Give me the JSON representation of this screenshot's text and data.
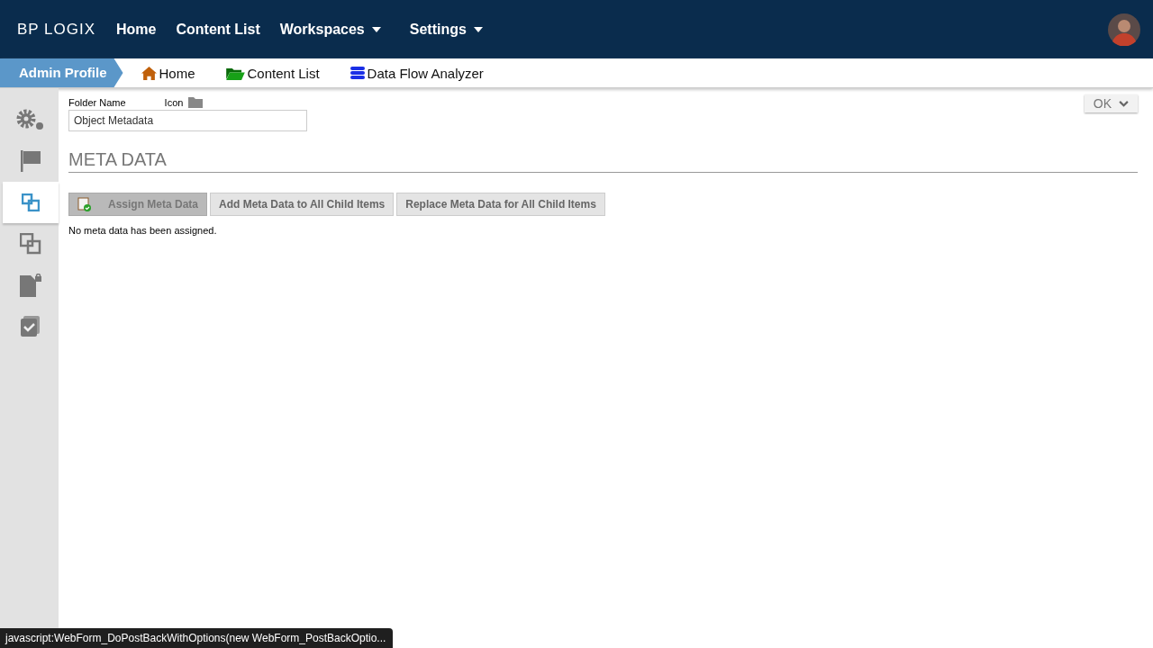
{
  "header": {
    "logo": "BP LOGIX",
    "nav": [
      {
        "label": "Home",
        "dropdown": false
      },
      {
        "label": "Content List",
        "dropdown": false
      },
      {
        "label": "Workspaces",
        "dropdown": true
      },
      {
        "label": "Settings",
        "dropdown": true
      }
    ]
  },
  "breadcrumb": {
    "current": "Admin Profile",
    "links": [
      {
        "label": "Home",
        "kind": "home"
      },
      {
        "label": "Content List",
        "kind": "folder"
      },
      {
        "label": "Data Flow Analyzer",
        "kind": "database"
      }
    ]
  },
  "sidebar": {
    "items": [
      {
        "kind": "gears",
        "selected": false
      },
      {
        "kind": "flag",
        "selected": false
      },
      {
        "kind": "squares",
        "selected": true
      },
      {
        "kind": "copies",
        "selected": false
      },
      {
        "kind": "locked-file",
        "selected": false
      },
      {
        "kind": "checklist",
        "selected": false
      }
    ]
  },
  "form": {
    "folder_name_label": "Folder Name",
    "icon_label": "Icon",
    "folder_name": "Object Metadata",
    "ok_button": "OK"
  },
  "section": {
    "title": "META DATA",
    "buttons": [
      {
        "label": "Assign Meta Data",
        "pressed": true
      },
      {
        "label": "Add Meta Data to All Child Items",
        "pressed": false
      },
      {
        "label": "Replace Meta Data for All Child Items",
        "pressed": false
      }
    ],
    "message": "No meta data has been assigned."
  },
  "status_bar": {
    "url": "javascript:WebForm_DoPostBackWithOptions(new WebForm_PostBackOptio..."
  }
}
